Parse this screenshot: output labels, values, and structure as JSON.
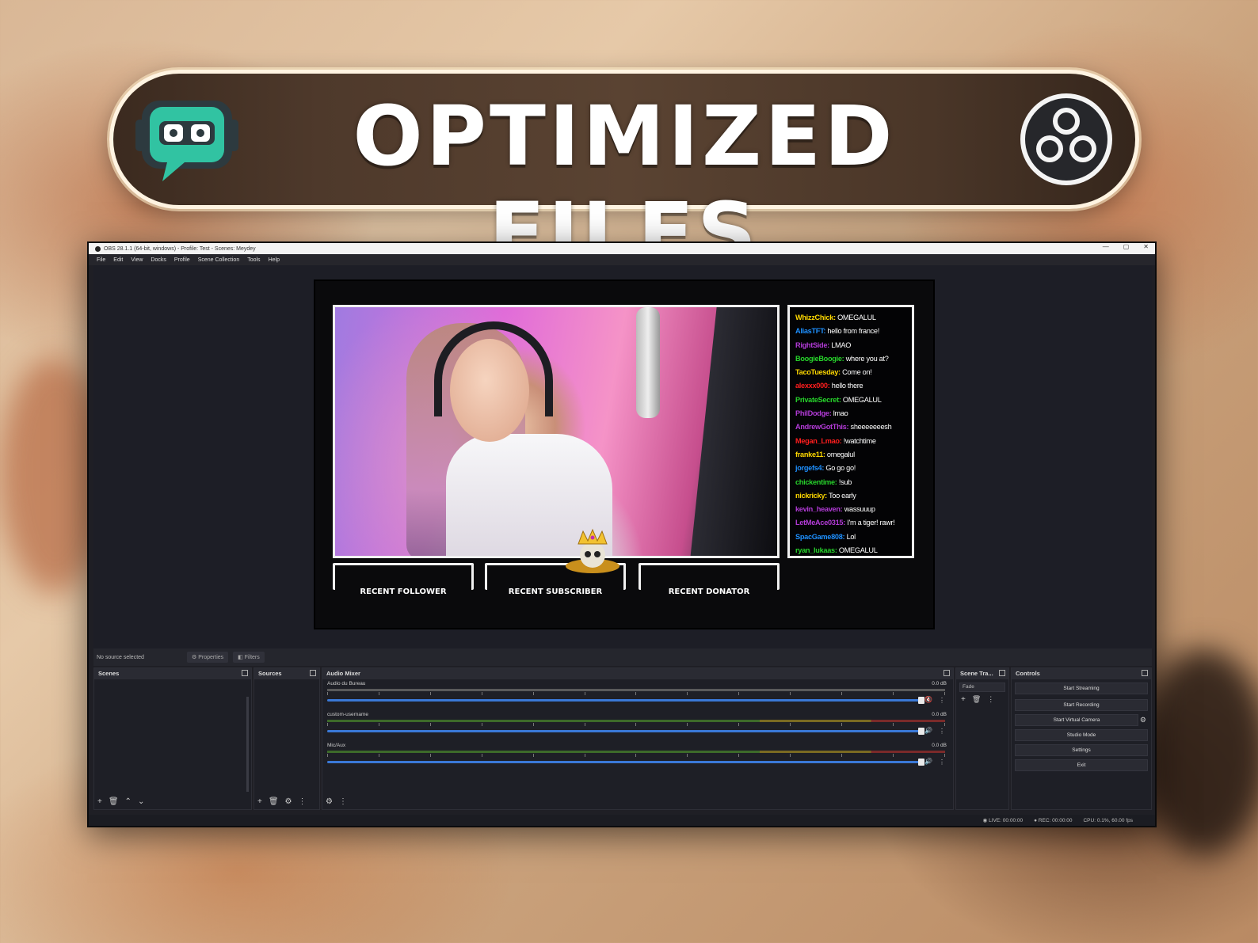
{
  "banner": {
    "title": "OPTIMIZED FILES"
  },
  "window": {
    "title": "OBS 28.1.1 (64-bit, windows) - Profile: Test - Scenes: Meydey",
    "controls": [
      "—",
      "▢",
      "✕"
    ],
    "menu": [
      "File",
      "Edit",
      "View",
      "Docks",
      "Profile",
      "Scene Collection",
      "Tools",
      "Help"
    ]
  },
  "overlay": {
    "chat": [
      {
        "user": "WhizzChick:",
        "msg": "OMEGALUL",
        "color": "#ffd900"
      },
      {
        "user": "AliasTFT:",
        "msg": "hello from france!",
        "color": "#1e90ff"
      },
      {
        "user": "RightSide:",
        "msg": "LMAO",
        "color": "#b23bd6"
      },
      {
        "user": "BoogieBoogie:",
        "msg": "where you at?",
        "color": "#27d32b"
      },
      {
        "user": "TacoTuesday:",
        "msg": "Come on!",
        "color": "#ffd900"
      },
      {
        "user": "alexxx000:",
        "msg": "hello there",
        "color": "#ff1e1e"
      },
      {
        "user": "PrivateSecret:",
        "msg": "OMEGALUL",
        "color": "#27d32b"
      },
      {
        "user": "PhilDodge:",
        "msg": "lmao",
        "color": "#b23bd6"
      },
      {
        "user": "AndrewGotThis:",
        "msg": "sheeeeeeesh",
        "color": "#b23bd6"
      },
      {
        "user": "Megan_Lmao:",
        "msg": "!watchtime",
        "color": "#ff1e1e"
      },
      {
        "user": "franke11:",
        "msg": "omegalul",
        "color": "#ffd900"
      },
      {
        "user": "jorgefs4:",
        "msg": "Go go go!",
        "color": "#1e90ff"
      },
      {
        "user": "chickentime:",
        "msg": "!sub",
        "color": "#27d32b"
      },
      {
        "user": "nickricky:",
        "msg": "Too early",
        "color": "#ffd900"
      },
      {
        "user": "kevin_heaven:",
        "msg": "wassuuup",
        "color": "#b23bd6"
      },
      {
        "user": "LetMeAce0315:",
        "msg": "I'm a tiger! rawr!",
        "color": "#b23bd6"
      },
      {
        "user": "SpacGame808:",
        "msg": "Lol",
        "color": "#1e90ff"
      },
      {
        "user": "ryan_lukaas:",
        "msg": "OMEGALUL",
        "color": "#27d32b"
      }
    ],
    "recent_follower": "RECENT FOLLOWER",
    "recent_subscriber": "RECENT SUBSCRIBER",
    "recent_donator": "RECENT DONATOR"
  },
  "source_bar": {
    "no_source": "No source selected",
    "properties": "Properties",
    "filters": "Filters"
  },
  "docks": {
    "scenes": "Scenes",
    "sources": "Sources",
    "audio_mixer": "Audio Mixer",
    "scene_transitions": "Scene Tra...",
    "transition_value": "Fade",
    "controls": "Controls"
  },
  "mixer": [
    {
      "name": "Audio du Bureau",
      "db": "0.0 dB",
      "muted": true
    },
    {
      "name": "custom-username",
      "db": "0.0 dB",
      "muted": false
    },
    {
      "name": "Mic/Aux",
      "db": "0.0 dB",
      "muted": false
    }
  ],
  "controls": {
    "start_streaming": "Start Streaming",
    "start_recording": "Start Recording",
    "start_virtual_camera": "Start Virtual Camera",
    "studio_mode": "Studio Mode",
    "settings": "Settings",
    "exit": "Exit"
  },
  "status": {
    "live": "LIVE: 00:00:00",
    "rec": "REC: 00:00:00",
    "cpu": "CPU: 0.1%, 60.00 fps"
  },
  "colors": {
    "accent": "#3a78d6",
    "obs_bg": "#1f1f25",
    "banner_border": "#fff4e2"
  },
  "icons": {
    "banner_left": "streamlabs-logo-icon",
    "banner_right": "obs-logo-icon",
    "add": "plus-icon",
    "remove": "trash-icon",
    "up": "chevron-up-icon",
    "down": "chevron-down-icon",
    "gear": "gear-icon"
  }
}
